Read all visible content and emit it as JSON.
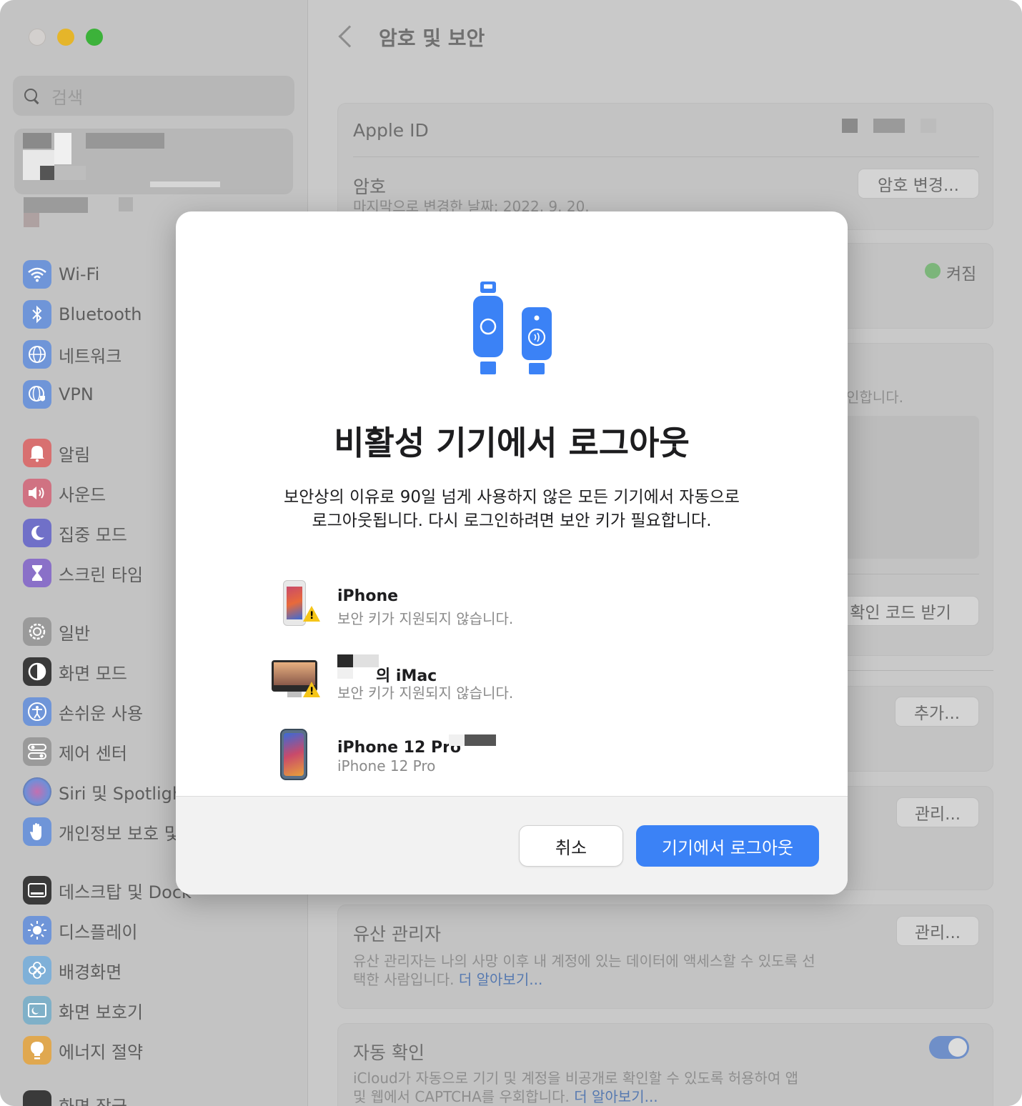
{
  "window": {
    "title": "암호 및 보안"
  },
  "sidebar": {
    "search_placeholder": "검색",
    "items": [
      {
        "label": "Wi-Fi",
        "icon": "wifi-icon",
        "color": "#6f95d8"
      },
      {
        "label": "Bluetooth",
        "icon": "bluetooth-icon",
        "color": "#6f95d8"
      },
      {
        "label": "네트워크",
        "icon": "globe-icon",
        "color": "#6f95d8"
      },
      {
        "label": "VPN",
        "icon": "vpn-globe-icon",
        "color": "#6f95d8"
      },
      {
        "label": "알림",
        "icon": "bell-icon",
        "color": "#d87070"
      },
      {
        "label": "사운드",
        "icon": "speaker-icon",
        "color": "#d07282"
      },
      {
        "label": "집중 모드",
        "icon": "moon-icon",
        "color": "#7070c8"
      },
      {
        "label": "스크린 타임",
        "icon": "hourglass-icon",
        "color": "#8a70c8"
      },
      {
        "label": "일반",
        "icon": "gear-icon",
        "color": "#9a9a9a"
      },
      {
        "label": "화면 모드",
        "icon": "appearance-icon",
        "color": "#3a3a3a"
      },
      {
        "label": "손쉬운 사용",
        "icon": "accessibility-icon",
        "color": "#6f95d8"
      },
      {
        "label": "제어 센터",
        "icon": "toggles-icon",
        "color": "#9a9a9a"
      },
      {
        "label": "Siri 및 Spotlight",
        "icon": "siri-icon",
        "color": "#8a6fb0"
      },
      {
        "label": "개인정보 보호 및 보안",
        "icon": "hand-icon",
        "color": "#6f95d8"
      },
      {
        "label": "데스크탑 및 Dock",
        "icon": "dock-icon",
        "color": "#3a3a3a"
      },
      {
        "label": "디스플레이",
        "icon": "sun-icon",
        "color": "#6f95d8"
      },
      {
        "label": "배경화면",
        "icon": "flower-icon",
        "color": "#7fb0d8"
      },
      {
        "label": "화면 보호기",
        "icon": "screensaver-icon",
        "color": "#7fb0c8"
      },
      {
        "label": "에너지 절약",
        "icon": "bulb-icon",
        "color": "#e0a850"
      },
      {
        "label": "화면 잠금",
        "icon": "lock-icon",
        "color": "#3a3a3a"
      }
    ]
  },
  "content": {
    "apple_id_label": "Apple ID",
    "password_label": "암호",
    "password_sub": "마지막으로 변경한 날짜: 2022. 9. 20.",
    "change_password_button": "암호 변경...",
    "on_status": "켜짐",
    "partial_text": "인합니다.",
    "get_code_button": "확인 코드 받기",
    "add_button": "추가...",
    "manage_button_1": "관리...",
    "legacy_title": "유산 관리자",
    "legacy_desc_1": "유산 관리자는 나의 사망 이후 내 계정에 있는 데이터에 액세스할 수 있도록 선",
    "legacy_desc_2": "택한 사람입니다.",
    "learn_more": "더 알아보기...",
    "manage_button_2": "관리...",
    "auto_verify_title": "자동 확인",
    "auto_verify_desc_1": "iCloud가 자동으로 기기 및 계정을 비공개로 확인할 수 있도록 허용하여 앱",
    "auto_verify_desc_2": "및 웹에서 CAPTCHA를 우회합니다.",
    "learn_more_2": "더 알아보기...",
    "toggle_on": true
  },
  "modal": {
    "title": "비활성 기기에서 로그아웃",
    "desc_line1": "보안상의 이유로 90일 넘게 사용하지 않은 모든 기기에서 자동으로",
    "desc_line2": "로그아웃됩니다. 다시 로그인하려면 보안 키가 필요합니다.",
    "devices": [
      {
        "name": "iPhone",
        "sub": "보안 키가 지원되지 않습니다.",
        "icon": "iphone-icon",
        "warning": true
      },
      {
        "name": "의 iMac",
        "sub": "보안 키가 지원되지 않습니다.",
        "icon": "imac-icon",
        "warning": true
      },
      {
        "name": "iPhone 12 Pro",
        "sub": "iPhone 12 Pro",
        "icon": "iphone-12-pro-icon",
        "warning": false
      }
    ],
    "cancel_button": "취소",
    "confirm_button": "기기에서 로그아웃",
    "accent_color": "#3b82f6"
  }
}
